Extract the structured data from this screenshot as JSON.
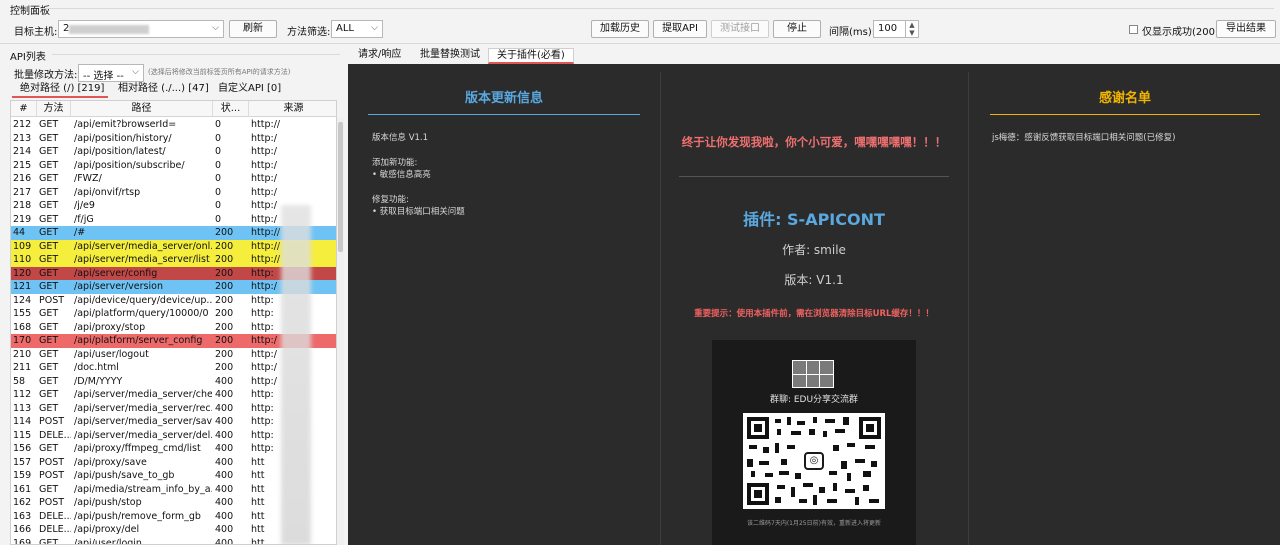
{
  "control_panel": {
    "title": "控制面板",
    "target_host_label": "目标主机:",
    "target_host_value": "2",
    "refresh_label": "刷新",
    "method_filter_label": "方法筛选:",
    "method_filter_value": "ALL",
    "load_history_label": "加载历史",
    "extract_api_label": "提取API",
    "test_api_label": "测试接口",
    "stop_label": "停止",
    "interval_label": "间隔(ms):",
    "interval_value": "100",
    "only_success_label": "仅显示成功(200)",
    "export_label": "导出结果"
  },
  "api_list": {
    "title": "API列表",
    "batch_label": "批量修改方法:",
    "batch_select": "-- 选择 --",
    "batch_hint": "(选择后将修改当前标签页所有API的请求方法)",
    "tabs": [
      {
        "label": "绝对路径 (/) [219]"
      },
      {
        "label": "相对路径 (./...) [47]"
      },
      {
        "label": "自定义API [0]"
      }
    ],
    "columns": [
      "#",
      "方法",
      "路径",
      "状...",
      "来源"
    ],
    "rows": [
      {
        "id": "212",
        "method": "GET",
        "path": "/api/emit?browserId=",
        "status": "0",
        "source": "http://",
        "hl": ""
      },
      {
        "id": "213",
        "method": "GET",
        "path": "/api/position/history/",
        "status": "0",
        "source": "http:/",
        "hl": ""
      },
      {
        "id": "214",
        "method": "GET",
        "path": "/api/position/latest/",
        "status": "0",
        "source": "http:/",
        "hl": ""
      },
      {
        "id": "215",
        "method": "GET",
        "path": "/api/position/subscribe/",
        "status": "0",
        "source": "http:/",
        "hl": ""
      },
      {
        "id": "216",
        "method": "GET",
        "path": "/FWZ/",
        "status": "0",
        "source": "http:/",
        "hl": ""
      },
      {
        "id": "217",
        "method": "GET",
        "path": "/api/onvif/rtsp",
        "status": "0",
        "source": "http:/",
        "hl": ""
      },
      {
        "id": "218",
        "method": "GET",
        "path": "/j/e9",
        "status": "0",
        "source": "http:/",
        "hl": ""
      },
      {
        "id": "219",
        "method": "GET",
        "path": "/f/jG",
        "status": "0",
        "source": "http:/",
        "hl": ""
      },
      {
        "id": "44",
        "method": "GET",
        "path": "/#",
        "status": "200",
        "source": "http://",
        "hl": "#6ec3f4"
      },
      {
        "id": "109",
        "method": "GET",
        "path": "/api/server/media_server/onl...",
        "status": "200",
        "source": "http://",
        "hl": "#f5ee3c"
      },
      {
        "id": "110",
        "method": "GET",
        "path": "/api/server/media_server/list",
        "status": "200",
        "source": "http://",
        "hl": "#f5ee3c"
      },
      {
        "id": "120",
        "method": "GET",
        "path": "/api/server/config",
        "status": "200",
        "source": "http:",
        "hl": "#c24848"
      },
      {
        "id": "121",
        "method": "GET",
        "path": "/api/server/version",
        "status": "200",
        "source": "http:/",
        "hl": "#6ec3f4"
      },
      {
        "id": "124",
        "method": "POST",
        "path": "/api/device/query/device/up...",
        "status": "200",
        "source": "http:",
        "hl": ""
      },
      {
        "id": "155",
        "method": "GET",
        "path": "/api/platform/query/10000/0",
        "status": "200",
        "source": "http:",
        "hl": ""
      },
      {
        "id": "168",
        "method": "GET",
        "path": "/api/proxy/stop",
        "status": "200",
        "source": "http:",
        "hl": ""
      },
      {
        "id": "170",
        "method": "GET",
        "path": "/api/platform/server_config",
        "status": "200",
        "source": "http:/",
        "hl": "#ee6a6a"
      },
      {
        "id": "210",
        "method": "GET",
        "path": "/api/user/logout",
        "status": "200",
        "source": "http:/",
        "hl": ""
      },
      {
        "id": "211",
        "method": "GET",
        "path": "/doc.html",
        "status": "200",
        "source": "http:/",
        "hl": ""
      },
      {
        "id": "58",
        "method": "GET",
        "path": "/D/M/YYYY",
        "status": "400",
        "source": "http:/",
        "hl": ""
      },
      {
        "id": "112",
        "method": "GET",
        "path": "/api/server/media_server/che...",
        "status": "400",
        "source": "http:",
        "hl": ""
      },
      {
        "id": "113",
        "method": "GET",
        "path": "/api/server/media_server/rec...",
        "status": "400",
        "source": "http:",
        "hl": ""
      },
      {
        "id": "114",
        "method": "POST",
        "path": "/api/server/media_server/save",
        "status": "400",
        "source": "http:",
        "hl": ""
      },
      {
        "id": "115",
        "method": "DELE...",
        "path": "/api/server/media_server/del...",
        "status": "400",
        "source": "http:",
        "hl": ""
      },
      {
        "id": "156",
        "method": "GET",
        "path": "/api/proxy/ffmpeg_cmd/list",
        "status": "400",
        "source": "http:",
        "hl": ""
      },
      {
        "id": "157",
        "method": "POST",
        "path": "/api/proxy/save",
        "status": "400",
        "source": "htt",
        "hl": ""
      },
      {
        "id": "159",
        "method": "POST",
        "path": "/api/push/save_to_gb",
        "status": "400",
        "source": "htt",
        "hl": ""
      },
      {
        "id": "161",
        "method": "GET",
        "path": "/api/media/stream_info_by_a...",
        "status": "400",
        "source": "htt",
        "hl": ""
      },
      {
        "id": "162",
        "method": "POST",
        "path": "/api/push/stop",
        "status": "400",
        "source": "htt",
        "hl": ""
      },
      {
        "id": "163",
        "method": "DELE...",
        "path": "/api/push/remove_form_gb",
        "status": "400",
        "source": "htt",
        "hl": ""
      },
      {
        "id": "166",
        "method": "DELE...",
        "path": "/api/proxy/del",
        "status": "400",
        "source": "htt",
        "hl": ""
      },
      {
        "id": "169",
        "method": "GET",
        "path": "/api/user/login",
        "status": "400",
        "source": "htt",
        "hl": ""
      }
    ]
  },
  "right_tabs": [
    {
      "label": "请求/响应"
    },
    {
      "label": "批量替换测试"
    },
    {
      "label": "关于插件(必看)"
    }
  ],
  "about": {
    "version_title": "版本更新信息",
    "version_info": "版本信息 V1.1",
    "added_title": "添加新功能:",
    "added_item": "• 敏感信息高亮",
    "fixed_title": "修复功能:",
    "fixed_item": "• 获取目标端口相关问题",
    "banner": "终于让你发现我啦，你个小可爱，嘿嘿嘿嘿嘿！！！",
    "plugin_name": "插件: S-APICONT",
    "author": "作者: smile",
    "version": "版本: V1.1",
    "warning": "重要提示：使用本插件前，需在浏览器清除目标URL缓存！！！",
    "qr_group": "群聊: EDU分享交流群",
    "qr_footer": "该二维码7天内(1月25日前)有效，重新进入将更新",
    "thanks_title": "感谢名单",
    "thanks_text": "js梅德：感谢反馈获取目标端口相关问题(已修复)"
  },
  "colors": {
    "accent_blue": "#5aa8e0",
    "accent_gold": "#f0b400",
    "warn_red": "#f06060",
    "row_blue": "#6ec3f4",
    "row_yellow": "#f5ee3c",
    "row_darkred": "#c24848",
    "row_red": "#ee6a6a"
  }
}
